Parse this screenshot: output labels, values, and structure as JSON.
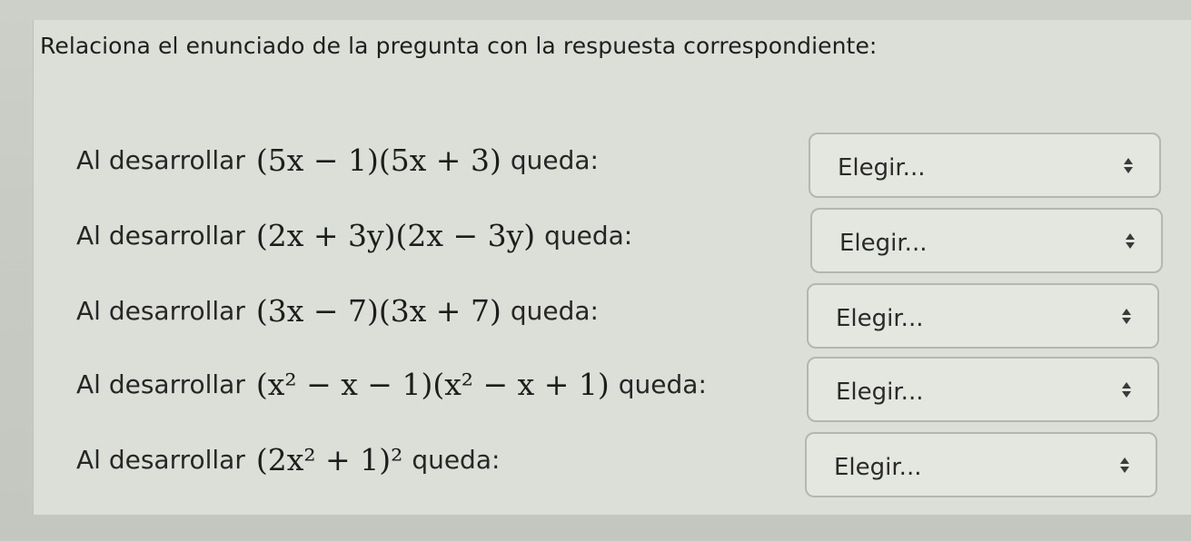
{
  "instruction": "Relaciona el enunciado de la pregunta con la respuesta correspondiente:",
  "items": [
    {
      "lead": "Al desarrollar",
      "expression": "(5x − 1)(5x + 3)",
      "tail": "queda:",
      "select_value": "Elegir..."
    },
    {
      "lead": "Al desarrollar",
      "expression": "(2x + 3y)(2x − 3y)",
      "tail": "queda:",
      "select_value": "Elegir..."
    },
    {
      "lead": "Al desarrollar",
      "expression": "(3x − 7)(3x + 7)",
      "tail": "queda:",
      "select_value": "Elegir..."
    },
    {
      "lead": "Al desarrollar",
      "expression": "(x² − x − 1)(x² − x + 1)",
      "tail": "queda:",
      "select_value": "Elegir..."
    },
    {
      "lead": "Al desarrollar",
      "expression": "(2x² + 1)²",
      "tail": "queda:",
      "select_value": "Elegir..."
    }
  ]
}
